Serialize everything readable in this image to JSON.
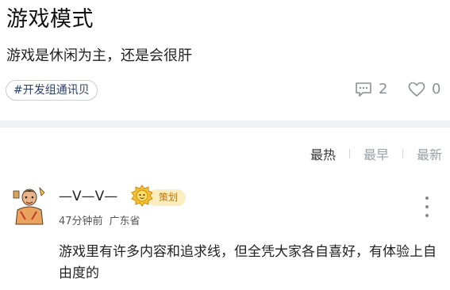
{
  "post": {
    "title": "游戏模式",
    "body": "游戏是休闲为主，还是会很肝",
    "tag": "#开发组通讯贝",
    "comment_count": "2",
    "like_count": "0"
  },
  "sort": {
    "options": [
      "最热",
      "最早",
      "最新"
    ],
    "active": "最热"
  },
  "comment": {
    "author": "—V—V—",
    "role_badge": "策划",
    "time": "47分钟前",
    "location": "广东省",
    "text": "游戏里有许多内容和追求线，但全凭大家各自喜好，有体验上自由度的"
  },
  "icons": {
    "comments": "comment-icon",
    "likes": "heart-icon",
    "more": "more-vertical-icon",
    "badge": "planner-badge-icon"
  },
  "colors": {
    "badge_bg": "#fbeebe",
    "badge_text": "#b7791a",
    "muted": "#9aa0a6",
    "tag_text": "#2a3d6b"
  }
}
